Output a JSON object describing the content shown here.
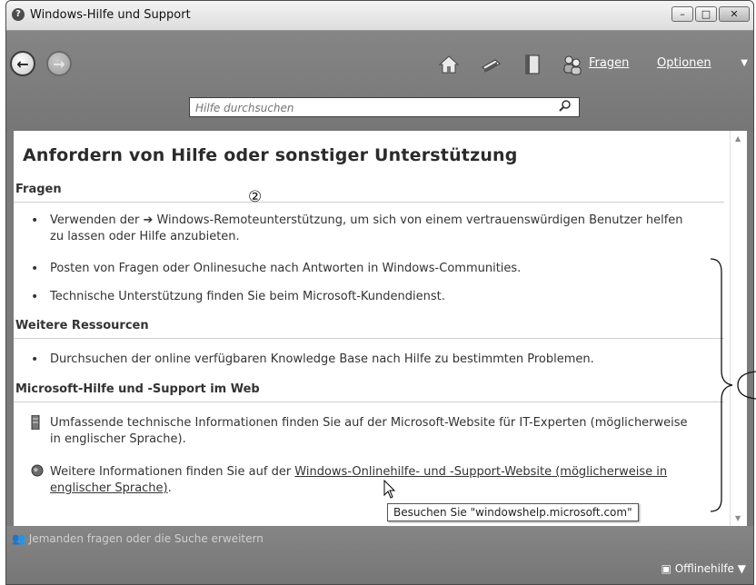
{
  "window": {
    "title": "Windows-Hilfe und Support"
  },
  "toolbar": {
    "fragen_label": "Fragen",
    "optionen_label": "Optionen",
    "search_placeholder": "Hilfe durchsuchen"
  },
  "content": {
    "heading": "Anfordern von Hilfe oder sonstiger Unterstützung",
    "sections": [
      {
        "title": "Fragen",
        "items": [
          {
            "prefix": "Verwenden der ",
            "link": "Windows-Remoteunterstützung",
            "suffix": ", um sich von einem vertrauenswürdigen Benutzer helfen zu lassen oder Hilfe anzubieten."
          },
          {
            "text": "Posten von Fragen oder Onlinesuche nach Antworten in Windows-Communities."
          },
          {
            "text": "Technische Unterstützung finden Sie beim Microsoft-Kundendienst."
          }
        ]
      },
      {
        "title": "Weitere Ressourcen",
        "items": [
          {
            "text": "Durchsuchen der online verfügbaren Knowledge Base nach Hilfe zu bestimmten Problemen."
          }
        ]
      },
      {
        "title": "Microsoft-Hilfe und -Support im Web",
        "items": [
          {
            "text": "Umfassende technische Informationen finden Sie auf der Microsoft-Website für IT-Experten (möglicherweise in englischer Sprache)."
          },
          {
            "prefix": "Weitere Informationen finden Sie auf der ",
            "link": "Windows-Onlinehilfe- und -Support-Website (möglicherweise in englischer Sprache)",
            "suffix": "."
          }
        ]
      }
    ]
  },
  "tooltip": "Besuchen Sie \"windowshelp.microsoft.com\"",
  "statusbar": {
    "ask_label": "Jemanden fragen oder die Suche erweitern",
    "offline_label": "Offlinehilfe"
  },
  "annotations": {
    "marker": "②"
  },
  "icons": {
    "back": "back-arrow-icon",
    "forward": "forward-arrow-icon",
    "home": "home-icon",
    "print": "print-icon",
    "browse": "book-icon",
    "ask": "people-icon",
    "search": "magnifier-icon",
    "server": "server-icon",
    "globe": "globe-icon",
    "offline": "computer-icon"
  }
}
